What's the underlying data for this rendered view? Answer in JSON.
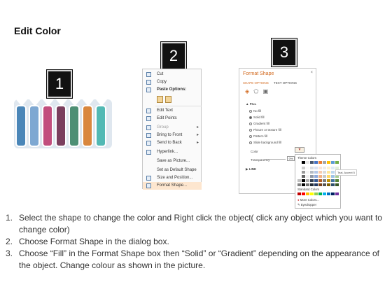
{
  "title": "Edit Color",
  "steps": [
    "1",
    "2",
    "3"
  ],
  "shape_colors": [
    "#4a86b8",
    "#7ea8d2",
    "#c24e7d",
    "#7b3f5e",
    "#4d8f74",
    "#d9873e",
    "#52b9b4"
  ],
  "context_menu": {
    "items": [
      {
        "label": "Cut",
        "icon": "scissors-icon"
      },
      {
        "label": "Copy",
        "icon": "copy-icon"
      },
      {
        "label": "Paste Options:",
        "icon": "paste-icon"
      },
      {
        "label": "Edit Text",
        "icon": "edit-text-icon"
      },
      {
        "label": "Edit Points",
        "icon": "edit-points-icon"
      },
      {
        "label": "Group",
        "icon": "group-icon"
      },
      {
        "label": "Bring to Front",
        "icon": "bring-front-icon"
      },
      {
        "label": "Send to Back",
        "icon": "send-back-icon"
      },
      {
        "label": "Hyperlink...",
        "icon": "hyperlink-icon"
      },
      {
        "label": "Save as Picture...",
        "icon": ""
      },
      {
        "label": "Set as Default Shape",
        "icon": ""
      },
      {
        "label": "Size and Position...",
        "icon": "size-icon"
      },
      {
        "label": "Format Shape...",
        "icon": "format-shape-icon"
      }
    ]
  },
  "format_pane": {
    "title": "Format Shape",
    "close": "×",
    "tabs": [
      "SHAPE OPTIONS",
      "TEXT OPTIONS"
    ],
    "fill_header": "▲ FILL",
    "fill_options": [
      "No fill",
      "Solid fill",
      "Gradient fill",
      "Picture or texture fill",
      "Pattern fill",
      "Slide background fill"
    ],
    "selected_fill": "Solid fill",
    "color_label": "Color",
    "transparency_label": "Transparency",
    "transparency_value": "0%",
    "line_header": "▶ LINE"
  },
  "palette": {
    "theme_label": "Theme Colors",
    "standard_label": "Standard Colors",
    "more_colors": "More Colors...",
    "eyedropper": "Eyedropper",
    "tooltip": "Teal, Accent 5",
    "theme_row": [
      "#ffffff",
      "#000000",
      "#e7e6e6",
      "#44546a",
      "#4472c4",
      "#ed7d31",
      "#a5a5a5",
      "#ffc000",
      "#5b9bd5",
      "#70ad47"
    ],
    "standard_row": [
      "#c00000",
      "#ff0000",
      "#ffc000",
      "#ffff00",
      "#92d050",
      "#00b050",
      "#00b0f0",
      "#0070c0",
      "#002060",
      "#7030a0"
    ]
  },
  "instructions": [
    {
      "num": "1.",
      "text": "Select the shape to change the color and Right click the object( click any object which you want to change color)"
    },
    {
      "num": "2.",
      "text": "Choose Format Shape in the dialog box."
    },
    {
      "num": "3.",
      "text": "Choose “Fill” in the Format Shape box then “Solid” or “Gradient” depending on the appearance of the object. Change colour as shown in the picture."
    }
  ]
}
